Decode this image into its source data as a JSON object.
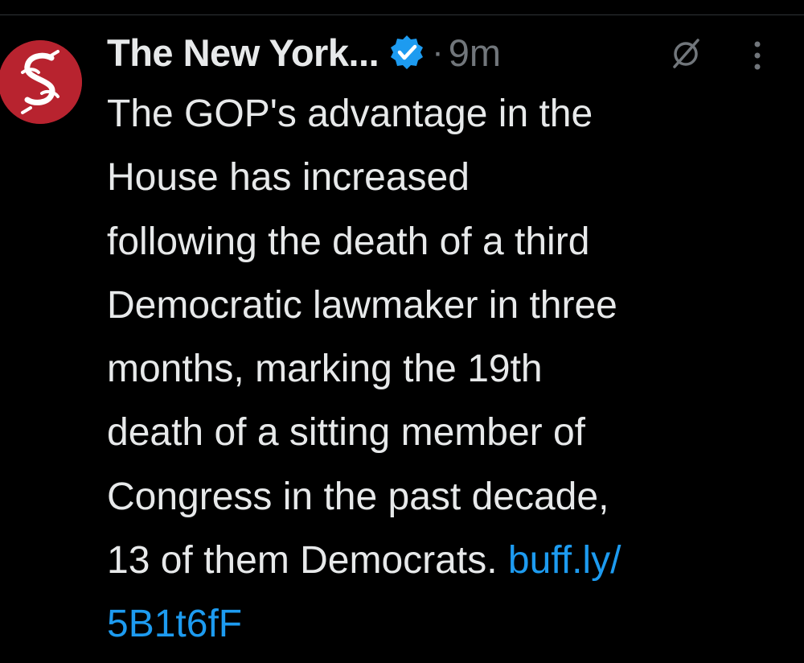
{
  "tweet": {
    "author": {
      "name": "The New York...",
      "verified": true,
      "avatar_color": "#b8232f"
    },
    "separator": "·",
    "timestamp": "9m",
    "text_lines": [
      "The GOP's advantage in the",
      "House has increased",
      "following the death of a third",
      "Democratic lawmaker in three",
      "months, marking the 19th",
      "death of a sitting member of",
      "Congress in the past decade,"
    ],
    "text_last_line_prefix": "13 of them Democrats.",
    "link": {
      "line1": "buff.ly/",
      "line2": "5B1t6fF",
      "color": "#1d9bf0"
    },
    "icons": {
      "verified": "verified-badge-icon",
      "grok": "grok-icon",
      "more": "more-options-icon"
    }
  },
  "colors": {
    "background": "#000000",
    "text": "#e7e9ea",
    "muted": "#71767b",
    "accent": "#1d9bf0"
  }
}
